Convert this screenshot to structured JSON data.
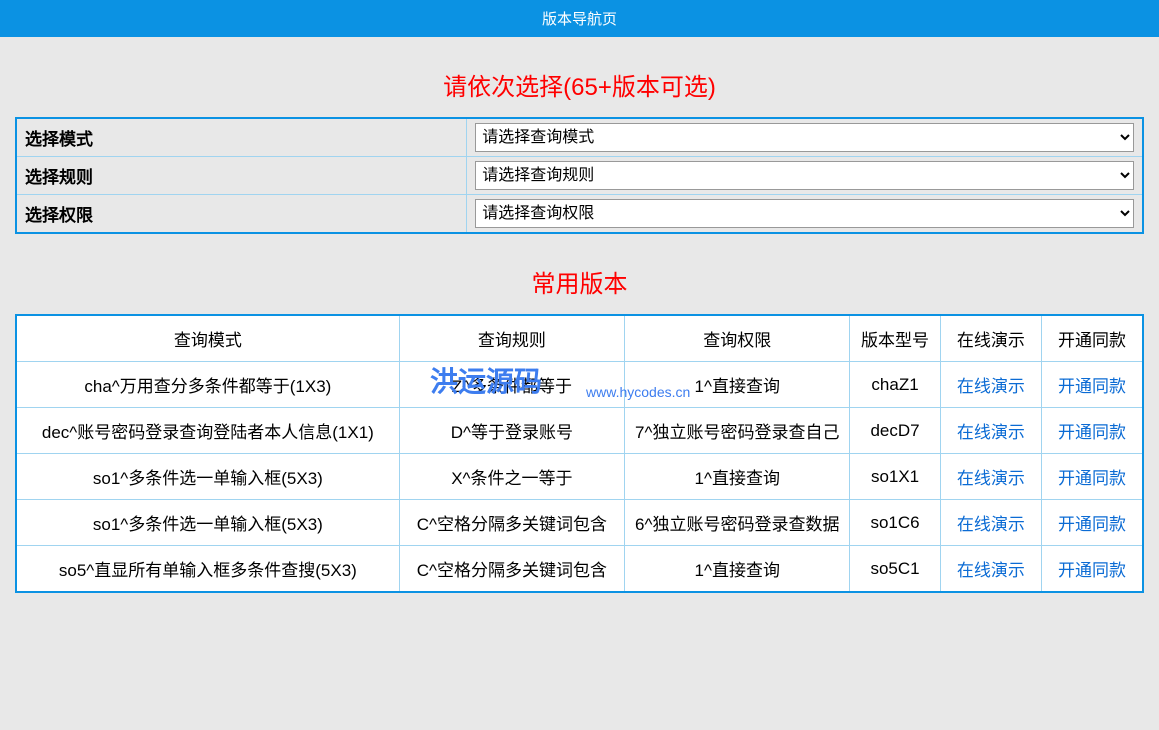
{
  "header": {
    "title": "版本导航页"
  },
  "section1": {
    "title": "请依次选择(65+版本可选)",
    "rows": [
      {
        "label": "选择模式",
        "selected": "请选择查询模式"
      },
      {
        "label": "选择规则",
        "selected": "请选择查询规则"
      },
      {
        "label": "选择权限",
        "selected": "请选择查询权限"
      }
    ]
  },
  "section2": {
    "title": "常用版本",
    "headers": {
      "mode": "查询模式",
      "rule": "查询规则",
      "perm": "查询权限",
      "model": "版本型号",
      "demo": "在线演示",
      "open": "开通同款"
    },
    "rows": [
      {
        "mode": "cha^万用查分多条件都等于(1X3)",
        "rule": "Z^多条件都等于",
        "perm": "1^直接查询",
        "model": "chaZ1",
        "demo": "在线演示",
        "open": "开通同款"
      },
      {
        "mode": "dec^账号密码登录查询登陆者本人信息(1X1)",
        "rule": "D^等于登录账号",
        "perm": "7^独立账号密码登录查自己",
        "model": "decD7",
        "demo": "在线演示",
        "open": "开通同款"
      },
      {
        "mode": "so1^多条件选一单输入框(5X3)",
        "rule": "X^条件之一等于",
        "perm": "1^直接查询",
        "model": "so1X1",
        "demo": "在线演示",
        "open": "开通同款"
      },
      {
        "mode": "so1^多条件选一单输入框(5X3)",
        "rule": "C^空格分隔多关键词包含",
        "perm": "6^独立账号密码登录查数据",
        "model": "so1C6",
        "demo": "在线演示",
        "open": "开通同款"
      },
      {
        "mode": "so5^直显所有单输入框多条件查搜(5X3)",
        "rule": "C^空格分隔多关键词包含",
        "perm": "1^直接查询",
        "model": "so5C1",
        "demo": "在线演示",
        "open": "开通同款"
      }
    ]
  },
  "watermark": {
    "text1": "洪运源码",
    "text2": "www.hycodes.cn"
  }
}
